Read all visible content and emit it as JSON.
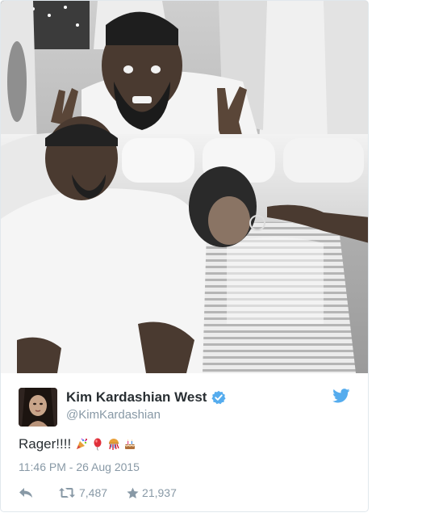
{
  "tweet": {
    "photo_description": "",
    "author": {
      "display_name": "Kim Kardashian West",
      "handle": "@KimKardashian",
      "verified": true
    },
    "text": "Rager!!!!",
    "emojis": [
      "party-popper-icon",
      "balloon-icon",
      "confetti-ball-icon",
      "birthday-cake-icon"
    ],
    "timestamp": "11:46 PM - 26 Aug 2015",
    "actions": {
      "retweet_count": "7,487",
      "favorite_count": "21,937"
    }
  },
  "colors": {
    "twitter_blue": "#55acee",
    "text_dark": "#292f33",
    "text_muted": "#8899a6",
    "border": "#e1e8ed"
  }
}
